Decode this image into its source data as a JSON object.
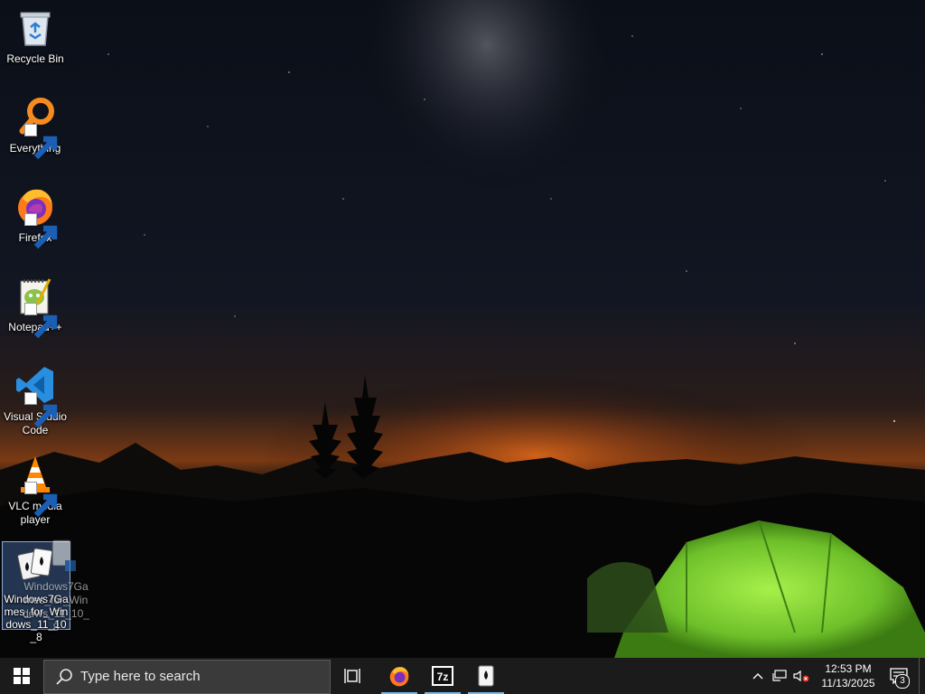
{
  "desktop": {
    "icons": [
      {
        "label": "Recycle Bin",
        "icon": "recycle-bin-icon"
      },
      {
        "label": "Everything",
        "icon": "everything-search-icon"
      },
      {
        "label": "Firefox",
        "icon": "firefox-icon"
      },
      {
        "label": "Notepad++",
        "icon": "notepadpp-icon"
      },
      {
        "label": "Visual Studio Code",
        "icon": "vscode-icon"
      },
      {
        "label": "VLC media player",
        "icon": "vlc-icon"
      },
      {
        "label": "Windows7Games_for_Windows_11_10_8",
        "icon": "solitaire-cards-icon"
      }
    ],
    "drag_ghost_label": "Windows7Games_for_Windows_11_10_8"
  },
  "taskbar": {
    "search_placeholder": "Type here to search",
    "pinned": [
      {
        "name": "Task View",
        "icon": "task-view-icon",
        "active": false
      },
      {
        "name": "Firefox",
        "icon": "firefox-icon",
        "active": true
      },
      {
        "name": "7-Zip",
        "icon": "7zip-icon",
        "active": true
      },
      {
        "name": "Windows7Games",
        "icon": "solitaire-cards-icon",
        "active": true
      }
    ],
    "tray": {
      "time": "12:53 PM",
      "date": "11/13/2025",
      "notification_count": "3"
    }
  },
  "colors": {
    "taskbar_bg": "#1b1b1c",
    "search_bg": "#3a3a3a",
    "active_underline": "#76b9ed"
  }
}
